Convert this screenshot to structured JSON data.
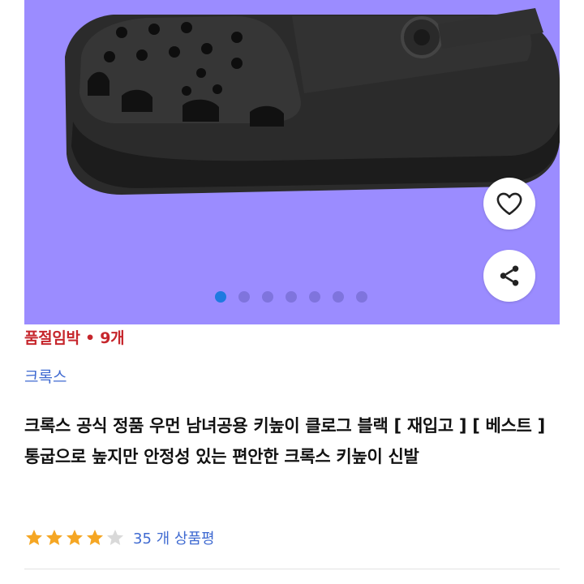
{
  "product": {
    "stock_status": "품절임박 • 9개",
    "brand": "크록스",
    "title": "크록스 공식 정품 우먼 남녀공용 키높이 클로그 블랙 [ 재입고 ] [ 베스트 ] 통굽으로 높지만 안정성 있는 편안한 크록스 키높이 신발",
    "rating": 4,
    "rating_max": 5,
    "review_count_text": "35 개 상품평"
  },
  "gallery": {
    "image_count": 7,
    "active_index": 0,
    "background_color": "#9b8cff",
    "like_icon": "heart-icon",
    "share_icon": "share-icon"
  },
  "colors": {
    "stock_status": "#c6262c",
    "link": "#3f6ad1",
    "star_filled": "#f5a623",
    "star_empty": "#d9d9d9",
    "dot_active": "#1f7ae0"
  }
}
